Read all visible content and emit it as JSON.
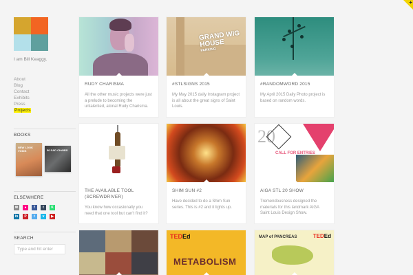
{
  "sidebar": {
    "intro": "I am Bill Keaggy.",
    "nav": [
      {
        "label": "About",
        "active": false
      },
      {
        "label": "Blog",
        "active": false
      },
      {
        "label": "Contact",
        "active": false
      },
      {
        "label": "Exhibits",
        "active": false
      },
      {
        "label": "Press",
        "active": false
      },
      {
        "label": "Projects",
        "active": true
      }
    ],
    "books_title": "BOOKS",
    "books": [
      {
        "name": "book-cover-1",
        "title": "NEW LOOK VOIDS"
      },
      {
        "name": "book-cover-2",
        "title": "50 SAD CHAIRS"
      }
    ],
    "elsewhere_title": "ELSEWHERE",
    "social": [
      {
        "icon": "email-icon",
        "glyph": "✉",
        "color": "#8a8a8a"
      },
      {
        "icon": "flickr-icon",
        "glyph": "●",
        "color": "#ff0084"
      },
      {
        "icon": "facebook-icon",
        "glyph": "f",
        "color": "#3b5998"
      },
      {
        "icon": "tumblr-icon",
        "glyph": "t",
        "color": "#35465c"
      },
      {
        "icon": "kickstarter-icon",
        "glyph": "K",
        "color": "#2bde73"
      },
      {
        "icon": "linkedin-icon",
        "glyph": "in",
        "color": "#0e76a8"
      },
      {
        "icon": "pinterest-icon",
        "glyph": "P",
        "color": "#cb2027"
      },
      {
        "icon": "twitter-icon",
        "glyph": "t",
        "color": "#55acee"
      },
      {
        "icon": "vimeo-icon",
        "glyph": "v",
        "color": "#1ab7ea"
      },
      {
        "icon": "youtube-icon",
        "glyph": "▶",
        "color": "#cd201f"
      }
    ],
    "search_title": "SEARCH",
    "search_placeholder": "Type and hit enter"
  },
  "projects": [
    {
      "title": "RUDY CHARISMA",
      "desc": "All the other music projects were just a prelude to becoming the untalented, atonal Rudy Charisma."
    },
    {
      "title": "#STLSIGNS 2015",
      "desc": "My May 2015 daily Instagram project is all about the great signs of Saint Louis."
    },
    {
      "title": "#RANDOMWORD 2015",
      "desc": "My April 2015 Daily Photo project is based on random words."
    },
    {
      "title": "THE AVAILABLE TOOL (SCREWDRIVER)",
      "desc": "You know how occasionally you need that one tool but can't find it?"
    },
    {
      "title": "SHIM SUN #2",
      "desc": "Have decided to do a Shim Sun series. This is #2 and it lights up."
    },
    {
      "title": "AIGA STL 20 SHOW",
      "desc": "Tremendousness designed the materials for this landmark AIGA Saint Louis Design Show."
    }
  ],
  "artwork_text": {
    "wig_sign": "GRAND WIG HOUSE",
    "wig_sub": "PARKING",
    "aiga_number": "20",
    "aiga_call": "CALL FOR ENTRIES",
    "ted": "TED",
    "ed": "Ed",
    "metab": "METABOLISM",
    "pancreas": "MAP of PANCREAS"
  }
}
